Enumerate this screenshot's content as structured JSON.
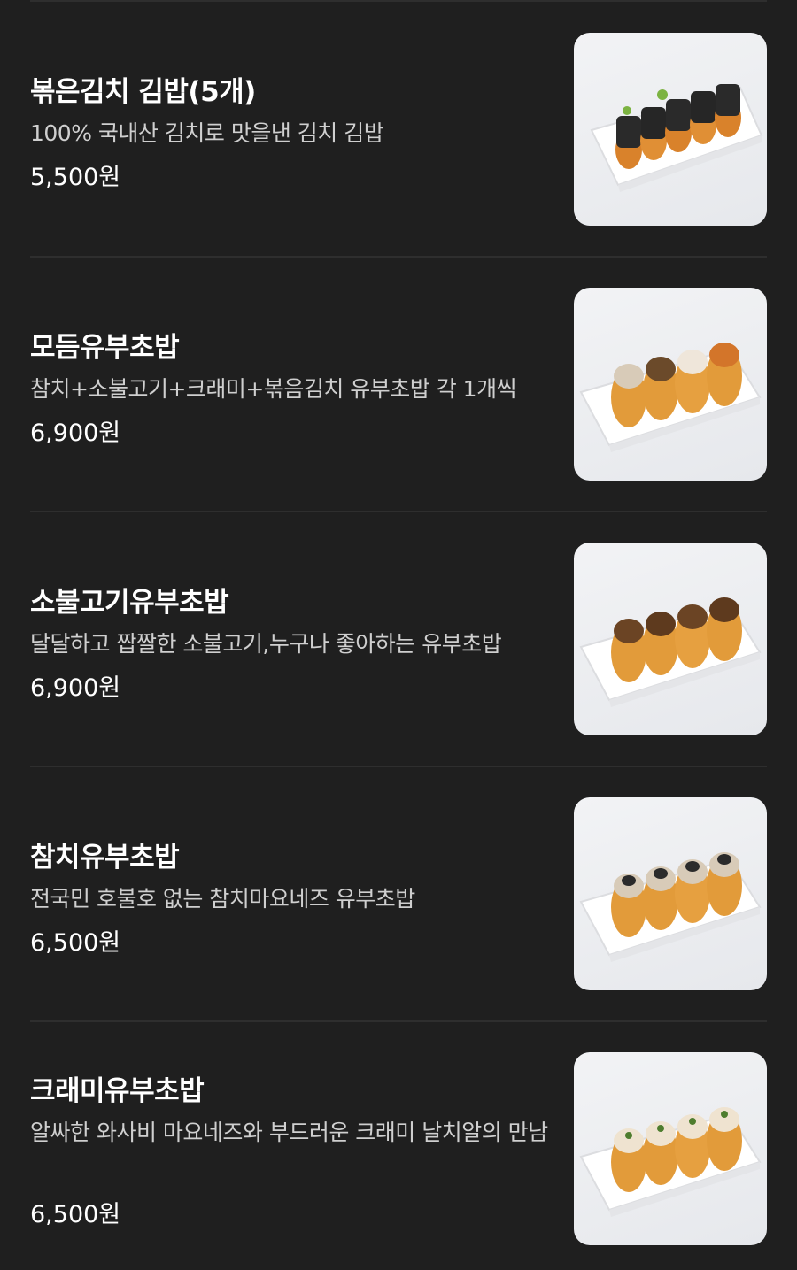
{
  "menu": {
    "items": [
      {
        "name": "볶은김치 김밥(5개)",
        "description": "100% 국내산 김치로 맛을낸 김치 김밥",
        "price": "5,500원",
        "image": "kimchi-kimbap-photo"
      },
      {
        "name": "모듬유부초밥",
        "description": "참치+소불고기+크래미+볶음김치 유부초밥 각 1개씩",
        "price": "6,900원",
        "image": "assorted-yubu-chobap-photo"
      },
      {
        "name": "소불고기유부초밥",
        "description": "달달하고 짭짤한 소불고기,누구나 좋아하는 유부초밥",
        "price": "6,900원",
        "image": "bulgogi-yubu-chobap-photo"
      },
      {
        "name": "참치유부초밥",
        "description": "전국민 호불호 없는 참치마요네즈 유부초밥",
        "price": "6,500원",
        "image": "tuna-yubu-chobap-photo"
      },
      {
        "name": "크래미유부초밥",
        "description": "알싸한 와사비 마요네즈와 부드러운 크래미 날치알의 만남",
        "price": "6,500원",
        "image": "crabmeat-yubu-chobap-photo"
      }
    ]
  }
}
